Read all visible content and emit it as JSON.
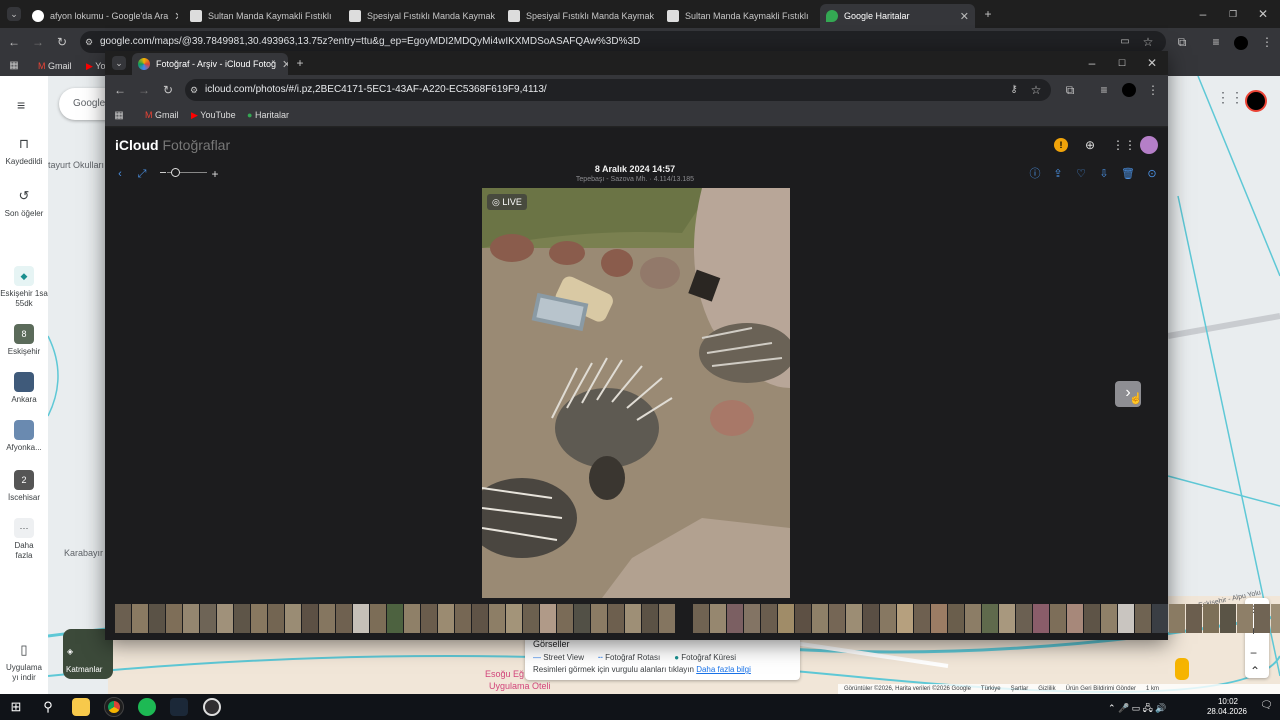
{
  "outer_browser": {
    "tabs": [
      {
        "title": "afyon lokumu - Google'da Ara",
        "active": false,
        "favicon": "google-icon"
      },
      {
        "title": "Sultan Manda Kaymakli Fıstıklı",
        "active": false,
        "favicon": "page-icon"
      },
      {
        "title": "Spesiyal Fıstıklı Manda Kaymakl",
        "active": false,
        "favicon": "page-icon"
      },
      {
        "title": "Spesiyal Fıstıklı Manda Kaymakl",
        "active": false,
        "favicon": "page-icon"
      },
      {
        "title": "Sultan Manda Kaymakli Fıstıklı",
        "active": false,
        "favicon": "page-icon"
      },
      {
        "title": "Google Haritalar",
        "active": true,
        "favicon": "maps-icon"
      }
    ],
    "url": "google.com/maps/@39.7849981,30.493963,13.75z?entry=ttu&g_ep=EgoyMDI2MDQyMi4wIKXMDSoASAFQAw%3D%3D",
    "bookmarks": [
      "Gmail",
      "Yo"
    ]
  },
  "maps": {
    "search_placeholder": "Google",
    "sidebar": [
      {
        "label": "Kaydedildi",
        "icon": "bookmark-icon"
      },
      {
        "label": "Son öğeler",
        "icon": "history-icon"
      },
      {
        "label": "Eskişehir 1sa 55dk",
        "icon": "directions-icon"
      },
      {
        "label": "Eskişehir",
        "icon": "place-thumb"
      },
      {
        "label": "Ankara",
        "icon": "place-thumb"
      },
      {
        "label": "Afyonka...",
        "icon": "place-thumb"
      },
      {
        "label": "İscehisar",
        "icon": "place-thumb"
      },
      {
        "label": "Daha fazla",
        "icon": "more-icon"
      },
      {
        "label": "Uygulama yı indir",
        "icon": "phone-icon"
      }
    ],
    "layers_label": "Katmanlar",
    "place_labels": {
      "tayurt": "tayurt Okulları",
      "karabayir": "Karabayır",
      "esogu": "Esoğu Eğ",
      "uygulama": "Uygulama Oteli",
      "eskisehir_road": "Eskişehir - Alpu Yolu"
    },
    "images_panel": {
      "title": "Görseller",
      "legend": [
        "Street View",
        "Fotoğraf Rotası",
        "Fotoğraf Küresi"
      ],
      "hint": "Resimleri görmek için vurgulu alanları tıklayın",
      "link": "Daha fazla bilgi"
    },
    "footer": [
      "Görüntüler ©2026, Harita verileri ©2026 Google",
      "Türkiye",
      "Şartlar",
      "Gizlilik",
      "Ürün Geri Bildirimi Gönder",
      "1 km"
    ]
  },
  "popup_browser": {
    "tab_title": "Fotoğraf - Arşiv - iCloud Fotoğ",
    "url": "icloud.com/photos/#/i.pz,2BEC4171-5EC1-43AF-A220-EC5368F619F9,4113/",
    "bookmarks": [
      "Gmail",
      "YouTube",
      "Haritalar"
    ]
  },
  "icloud": {
    "brand": "iCloud",
    "section": "Fotoğraflar",
    "photo_date": "8 Aralık 2024 14:57",
    "photo_meta": "Tepebaşı - Sazova Mh. · 4.114/13.185",
    "live_badge": "LIVE",
    "zoom_level": 0.1,
    "toolbar_icons": [
      "info-icon",
      "share-icon",
      "favorite-icon",
      "download-icon",
      "delete-icon",
      "more-icon"
    ],
    "thumbnail_colors": [
      "#6b5f50",
      "#8a7a62",
      "#5a5246",
      "#7e6e58",
      "#948670",
      "#6e6456",
      "#a0917a",
      "#5e5548",
      "#887860",
      "#736552",
      "#9a8c74",
      "#5c5044",
      "#857660",
      "#6f6150",
      "#c6c0b8",
      "#7c6d57",
      "#4d6240",
      "#8f8068",
      "#6a5c4c",
      "#9b8b71",
      "#766754",
      "#5f5346",
      "#8d7e66",
      "#a39479",
      "#6c604f",
      "#b09a88",
      "#7a6b57",
      "#525046",
      "#8b7b64",
      "#6d5f4e",
      "#9e8f76",
      "#5b5245",
      "#847560",
      "#1c1c1e",
      "#706352",
      "#96876f",
      "#7b5f62",
      "#837464",
      "#6a5d4e",
      "#a08c68",
      "#5d5044",
      "#8e8068",
      "#756655",
      "#9c8d74",
      "#5a4f44",
      "#877862",
      "#b6a07e",
      "#6e6050",
      "#9b7c64",
      "#6a5e4c",
      "#8c7d66",
      "#5f6a4c",
      "#a8987e",
      "#6b6052",
      "#8a5d6a",
      "#7d6e59",
      "#a7887a",
      "#5e5447",
      "#8f8068",
      "#c9c5c0",
      "#6f6352",
      "#3a3e44",
      "#8a7b63",
      "#6b5e4e",
      "#7d7058",
      "#5a5446",
      "#8e7f68",
      "#706454",
      "#9d8e75",
      "#6a5f50"
    ]
  },
  "taskbar": {
    "apps": [
      "windows-start-icon",
      "search-icon",
      "file-explorer-icon",
      "chrome-icon",
      "spotify-icon",
      "steam-icon",
      "obs-icon"
    ],
    "time": "10:02",
    "date": "28.04.2026"
  }
}
